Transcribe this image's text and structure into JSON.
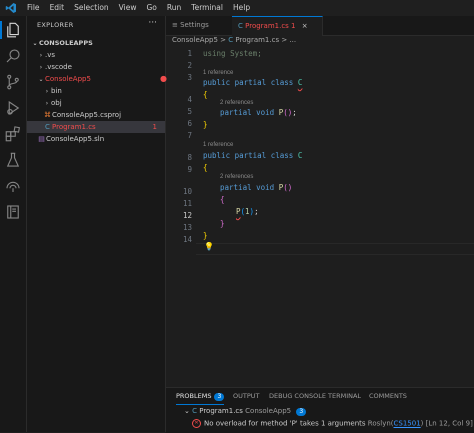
{
  "menu": [
    "File",
    "Edit",
    "Selection",
    "View",
    "Go",
    "Run",
    "Terminal",
    "Help"
  ],
  "sidebar": {
    "title": "EXPLORER",
    "more": "···",
    "items": [
      {
        "label": "CONSOLEAPPS",
        "level": 0,
        "chevron": "v"
      },
      {
        "label": ".vs",
        "level": 1,
        "chevron": ">"
      },
      {
        "label": ".vscode",
        "level": 1,
        "chevron": ">"
      },
      {
        "label": "ConsoleApp5",
        "level": 1,
        "chevron": "v"
      },
      {
        "label": "bin",
        "level": 2,
        "chevron": ">"
      },
      {
        "label": "obj",
        "level": 2,
        "chevron": ">"
      },
      {
        "label": "ConsoleApp5.csproj",
        "level": 2,
        "chevron": ""
      },
      {
        "label": "Program1.cs",
        "level": 2,
        "chevron": "",
        "badge": "1"
      },
      {
        "label": "ConsoleApp5.sln",
        "level": 1,
        "chevron": ""
      }
    ]
  },
  "tabs": {
    "settings": "Settings",
    "program": "Program1.cs 1",
    "close": "×"
  },
  "breadcrumb": {
    "project": "ConsoleApp5",
    "sep": ">",
    "file": "Program1.cs"
  },
  "code": {
    "line_numbers": [
      "1",
      "2",
      "3",
      "4",
      "5",
      "6",
      "7",
      "8",
      "9",
      "10",
      "11",
      "12",
      "13",
      "14"
    ],
    "lens_1_ref": "1 reference",
    "lens_2_refs": "2 references",
    "l1_using": "using",
    "l1_ns": "System",
    "l1_semi": ";",
    "kw_public": "public",
    "kw_partial": "partial",
    "kw_class": "class",
    "class_name": "C",
    "kw_void": "void",
    "method": "P",
    "call_arg": "1"
  },
  "panel": {
    "tabs": {
      "problems": "PROBLEMS",
      "output": "OUTPUT",
      "debug": "DEBUG CONSOLE",
      "terminal": "TERMINAL",
      "comments": "COMMENTS"
    },
    "problem_count": "3",
    "file": "Program1.cs",
    "folder": "ConsoleApp5",
    "file_count": "3",
    "message": "No overload for method 'P' takes 1 arguments",
    "source": "Roslyn",
    "code": "CS1501",
    "location": "[Ln 12, Col 9]"
  },
  "colors": {
    "accent": "#0078d4",
    "error": "#f14c4c"
  }
}
